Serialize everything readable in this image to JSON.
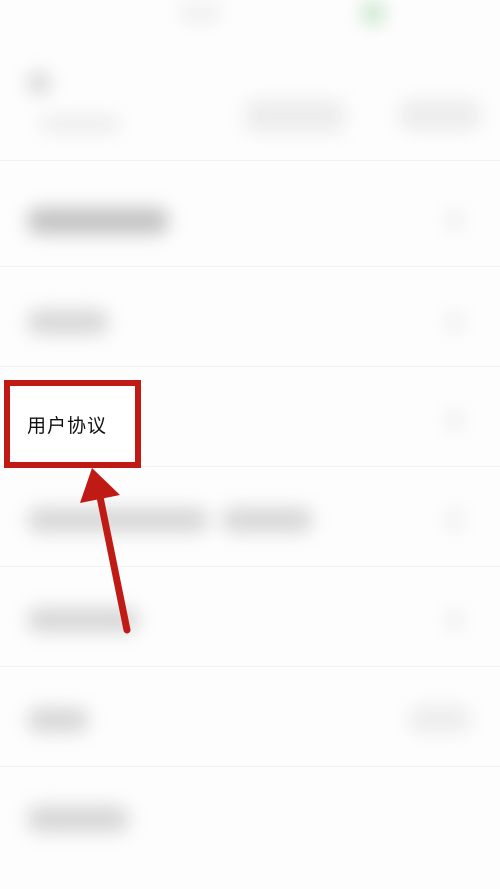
{
  "screen": {
    "highlighted_item_label": "用户协议"
  },
  "annotation": {
    "box_color": "#c01a14",
    "arrow_color": "#c01a14"
  }
}
